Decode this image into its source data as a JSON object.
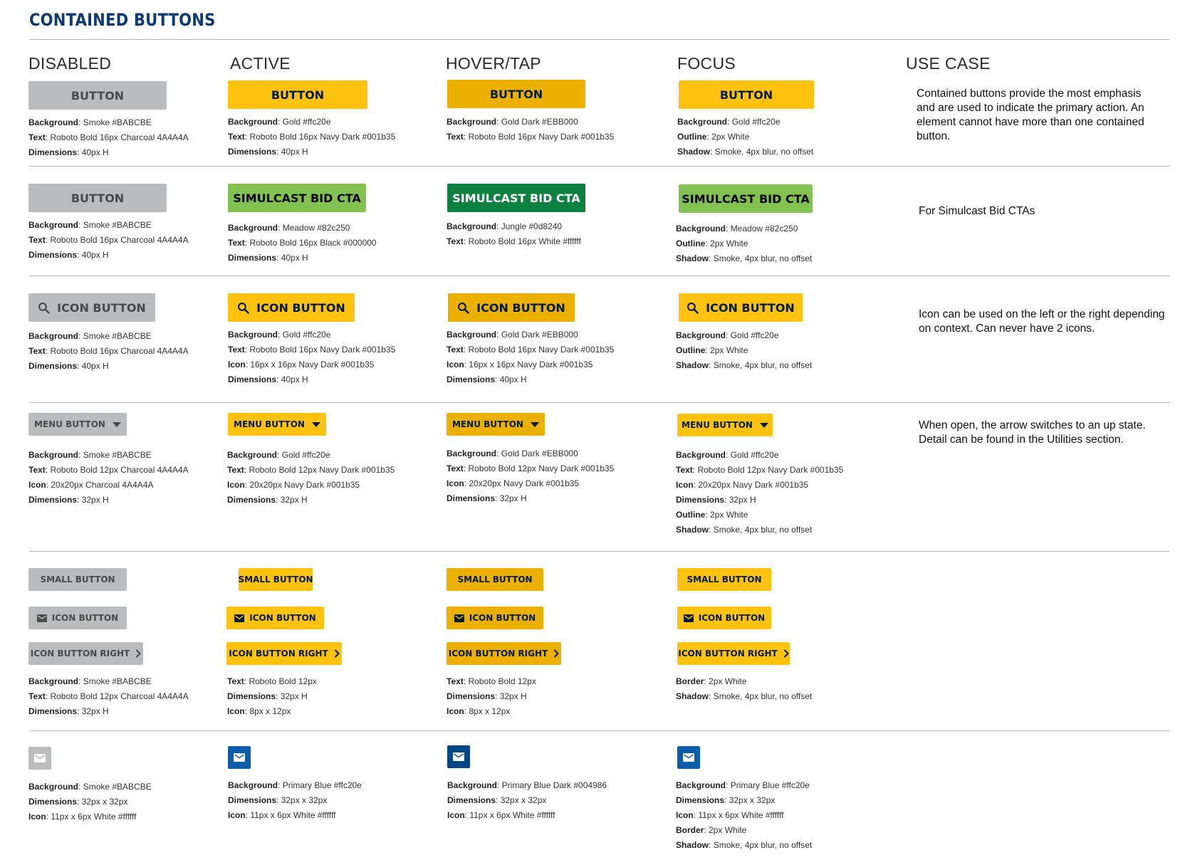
{
  "title": "CONTAINED BUTTONS",
  "columns": [
    "DISABLED",
    "ACTIVE",
    "HOVER/TAP",
    "FOCUS",
    "USE CASE"
  ],
  "colors": {
    "smoke": "#BABCBE",
    "charcoal": "#4A4A4A",
    "gold": "#ffc20e",
    "gold_dark": "#EBB000",
    "navy_dark": "#001b35",
    "meadow": "#82c250",
    "jungle": "#0d8240",
    "primary_blue": "#0b5cab",
    "primary_blue_dark": "#004986",
    "title_blue": "#0d3b73"
  },
  "row1": {
    "label": "BUTTON",
    "disabled": [
      [
        "Background",
        "Smoke #BABCBE"
      ],
      [
        "Text",
        "Roboto Bold 16px Charcoal 4A4A4A"
      ],
      [
        "Dimensions",
        "40px H"
      ]
    ],
    "active": [
      [
        "Background",
        "Gold #ffc20e"
      ],
      [
        "Text",
        "Roboto Bold 16px Navy Dark #001b35"
      ],
      [
        "Dimensions",
        "40px H"
      ]
    ],
    "hover": [
      [
        "Background",
        "Gold Dark #EBB000"
      ],
      [
        "Text",
        "Roboto Bold 16px Navy Dark #001b35"
      ]
    ],
    "focus": [
      [
        "Background",
        "Gold #ffc20e"
      ],
      [
        "Outline",
        "2px White"
      ],
      [
        "Shadow",
        "Smoke, 4px blur, no offset"
      ]
    ],
    "usecase": "Contained buttons provide the most emphasis and are used to indicate the primary action. An element cannot have more than one contained button."
  },
  "row2": {
    "disabled_label": "BUTTON",
    "cta_label": "SIMULCAST BID CTA",
    "disabled": [
      [
        "Background",
        "Smoke #BABCBE"
      ],
      [
        "Text",
        "Roboto Bold 16px Charcoal 4A4A4A"
      ],
      [
        "Dimensions",
        "40px H"
      ]
    ],
    "active": [
      [
        "Background",
        "Meadow #82c250"
      ],
      [
        "Text",
        "Roboto Bold 16px Black #000000"
      ],
      [
        "Dimensions",
        "40px H"
      ]
    ],
    "hover": [
      [
        "Background",
        "Jungle #0d8240"
      ],
      [
        "Text",
        "Roboto Bold 16px White #ffffff"
      ]
    ],
    "focus": [
      [
        "Background",
        "Meadow #82c250"
      ],
      [
        "Outline",
        "2px White"
      ],
      [
        "Shadow",
        "Smoke, 4px blur, no offset"
      ]
    ],
    "usecase": "For Simulcast Bid CTAs"
  },
  "row3": {
    "label": "ICON BUTTON",
    "icon": "search-icon",
    "disabled": [
      [
        "Background",
        "Smoke #BABCBE"
      ],
      [
        "Text",
        "Roboto Bold 16px Charcoal 4A4A4A"
      ],
      [
        "Dimensions",
        "40px H"
      ]
    ],
    "active": [
      [
        "Background",
        "Gold #ffc20e"
      ],
      [
        "Text",
        "Roboto Bold 16px Navy Dark #001b35"
      ],
      [
        "Icon",
        "16px x 16px Navy Dark #001b35"
      ],
      [
        "Dimensions",
        "40px H"
      ]
    ],
    "hover": [
      [
        "Background",
        "Gold Dark #EBB000"
      ],
      [
        "Text",
        "Roboto Bold 16px Navy Dark #001b35"
      ],
      [
        "Icon",
        "16px x 16px Navy Dark #001b35"
      ],
      [
        "Dimensions",
        "40px H"
      ]
    ],
    "focus": [
      [
        "Background",
        "Gold #ffc20e"
      ],
      [
        "Outline",
        "2px White"
      ],
      [
        "Shadow",
        "Smoke, 4px blur, no offset"
      ]
    ],
    "usecase": "Icon can be used on the left or the right depending on context. Can never have 2 icons."
  },
  "row4": {
    "label": "MENU BUTTON",
    "icon": "caret-down-icon",
    "disabled": [
      [
        "Background",
        "Smoke #BABCBE"
      ],
      [
        "Text",
        "Roboto Bold 12px Charcoal 4A4A4A"
      ],
      [
        "Icon",
        "20x20px Charcoal 4A4A4A"
      ],
      [
        "Dimensions",
        "32px H"
      ]
    ],
    "active": [
      [
        "Background",
        "Gold #ffc20e"
      ],
      [
        "Text",
        "Roboto Bold 12px Navy Dark #001b35"
      ],
      [
        "Icon",
        "20x20px Navy Dark #001b35"
      ],
      [
        "Dimensions",
        "32px H"
      ]
    ],
    "hover": [
      [
        "Background",
        "Gold Dark #EBB000"
      ],
      [
        "Text",
        "Roboto Bold 12px Navy Dark #001b35"
      ],
      [
        "Icon",
        "20x20px Navy Dark #001b35"
      ],
      [
        "Dimensions",
        "32px H"
      ]
    ],
    "focus": [
      [
        "Background",
        "Gold #ffc20e"
      ],
      [
        "Text",
        "Roboto Bold 12px Navy Dark #001b35"
      ],
      [
        "Icon",
        "20x20px Navy Dark #001b35"
      ],
      [
        "Dimensions",
        "32px H"
      ],
      [
        "Outline",
        "2px White"
      ],
      [
        "Shadow",
        "Smoke, 4px blur, no offset"
      ]
    ],
    "usecase": "When open, the arrow switches to an up state. Detail can be found in the Utilities section."
  },
  "row5": {
    "small_label": "SMALL BUTTON",
    "icon_label": "ICON BUTTON",
    "icon_right_label": "ICON BUTTON RIGHT",
    "icon": "mail-icon",
    "icon_right": "chevron-right-icon",
    "disabled": [
      [
        "Background",
        "Smoke #BABCBE"
      ],
      [
        "Text",
        "Roboto Bold 12px Charcoal 4A4A4A"
      ],
      [
        "Dimensions",
        "32px H"
      ]
    ],
    "active": [
      [
        "Text",
        "Roboto Bold 12px"
      ],
      [
        "Dimensions",
        "32px H"
      ],
      [
        "Icon",
        "8px x 12px"
      ]
    ],
    "hover": [
      [
        "Text",
        "Roboto Bold 12px"
      ],
      [
        "Dimensions",
        "32px H"
      ],
      [
        "Icon",
        "8px x 12px"
      ]
    ],
    "focus": [
      [
        "Border",
        "2px White"
      ],
      [
        "Shadow",
        "Smoke, 4px blur, no offset"
      ]
    ]
  },
  "row6": {
    "icon": "mail-icon",
    "disabled": [
      [
        "Background",
        "Smoke #BABCBE"
      ],
      [
        "Dimensions",
        "32px x 32px"
      ],
      [
        "Icon",
        "11px x 6px White #ffffff"
      ]
    ],
    "active": [
      [
        "Background",
        "Primary Blue #ffc20e"
      ],
      [
        "Dimensions",
        "32px x 32px"
      ],
      [
        "Icon",
        "11px x 6px White #ffffff"
      ]
    ],
    "hover": [
      [
        "Background",
        "Primary Blue Dark #004986"
      ],
      [
        "Dimensions",
        "32px x 32px"
      ],
      [
        "Icon",
        "11px x 6px White #ffffff"
      ]
    ],
    "focus": [
      [
        "Background",
        "Primary Blue #ffc20e"
      ],
      [
        "Dimensions",
        "32px x 32px"
      ],
      [
        "Icon",
        "11px x 6px White #ffffff"
      ],
      [
        "Border",
        "2px White"
      ],
      [
        "Shadow",
        "Smoke, 4px blur, no offset"
      ]
    ]
  }
}
